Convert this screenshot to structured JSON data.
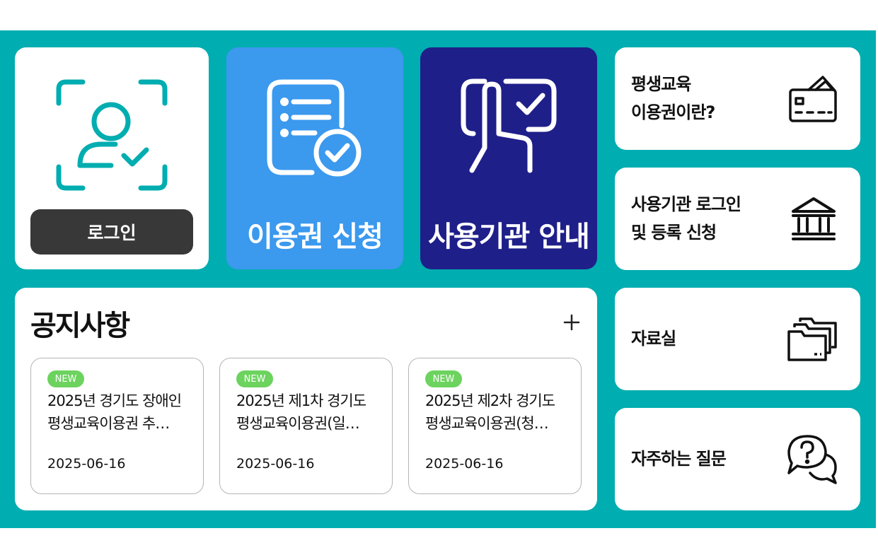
{
  "tiles": {
    "login_button": "로그인",
    "apply_label": "이용권 신청",
    "institution_label": "사용기관 안내"
  },
  "side": [
    {
      "line1": "평생교육",
      "line2": "이용권이란?",
      "icon": "card-icon"
    },
    {
      "line1": "사용기관 로그인",
      "line2": "및 등록 신청",
      "icon": "bank-icon"
    },
    {
      "line1": "자료실",
      "icon": "folder-icon"
    },
    {
      "line1": "자주하는 질문",
      "icon": "faq-icon"
    }
  ],
  "notice": {
    "title": "공지사항",
    "more_icon": "plus-icon",
    "items": [
      {
        "badge": "NEW",
        "line1": "2025년 경기도 장애인",
        "line2": "평생교육이용권 추…",
        "date": "2025-06-16"
      },
      {
        "badge": "NEW",
        "line1": "2025년 제1차 경기도",
        "line2": "평생교육이용권(일…",
        "date": "2025-06-16"
      },
      {
        "badge": "NEW",
        "line1": "2025년 제2차 경기도",
        "line2": "평생교육이용권(청…",
        "date": "2025-06-16"
      }
    ]
  },
  "colors": {
    "background_teal": "#00adb0",
    "apply_blue": "#3b99ee",
    "institution_navy": "#1f1f8a",
    "login_button": "#383838",
    "new_badge": "#6cd35e"
  }
}
